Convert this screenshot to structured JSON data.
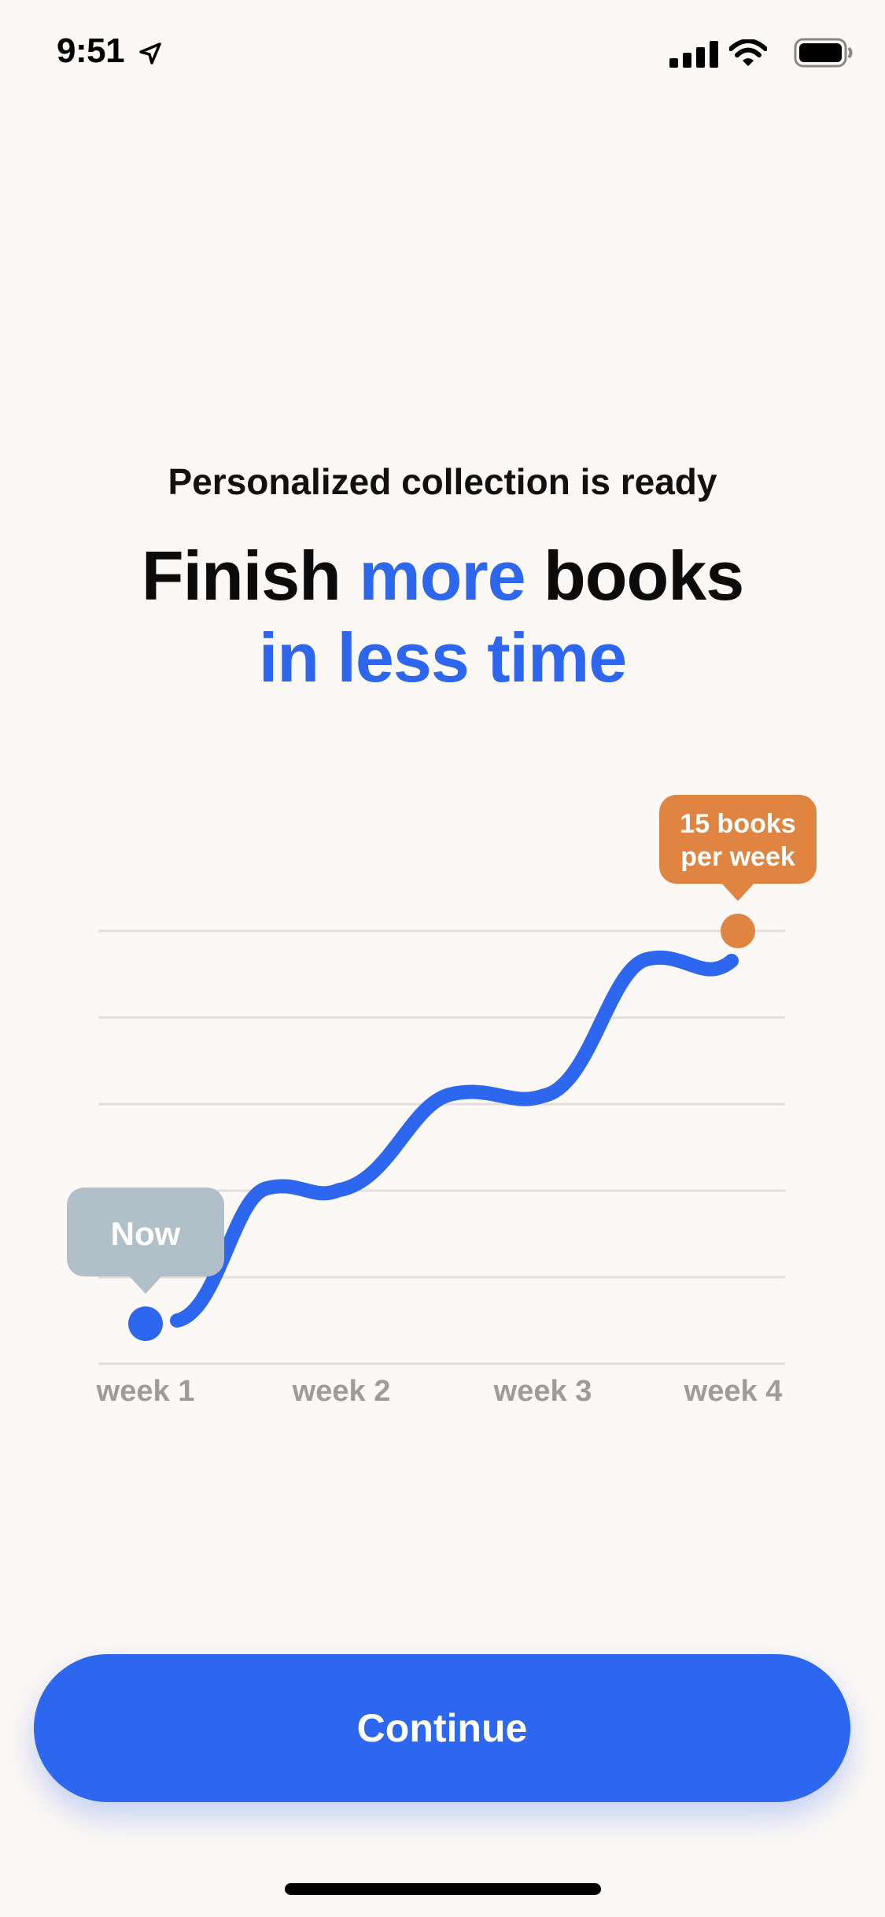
{
  "status_bar": {
    "time": "9:51",
    "icons": [
      "location-arrow-icon",
      "cellular-signal-icon",
      "wifi-icon",
      "battery-icon"
    ]
  },
  "header": {
    "subtitle": "Personalized collection is ready",
    "headline_line1": [
      "Finish ",
      "more",
      " books"
    ],
    "headline_line2": "in less time"
  },
  "colors": {
    "accent": "#2d66ef",
    "goal": "#e08541",
    "now_bubble": "#b1bfc8",
    "background": "#fcf8f5"
  },
  "chart_data": {
    "type": "line",
    "categories": [
      "week 1",
      "week 2",
      "week 3",
      "week 4"
    ],
    "series": [
      {
        "values": [
          1,
          4.4,
          6.8,
          11
        ]
      }
    ],
    "annotations": [
      {
        "label": "Now",
        "at": "week 1"
      },
      {
        "label": "15 books\nper week",
        "at": "week 4"
      }
    ],
    "grid": true,
    "ylim": [
      0,
      12
    ]
  },
  "footer": {
    "continue_label": "Continue"
  }
}
